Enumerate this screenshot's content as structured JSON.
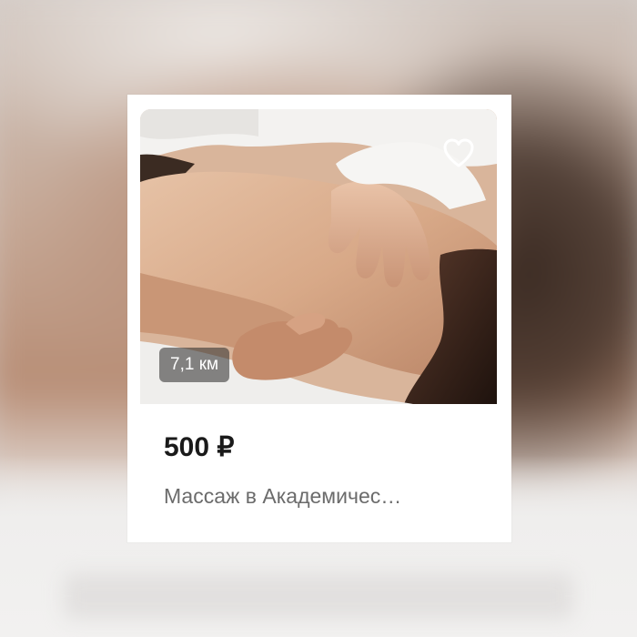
{
  "listing": {
    "price": "500 ₽",
    "title": "Массаж в Академичес…",
    "distance": "7,1 км",
    "favorite_icon": "heart-outline-icon",
    "photo_subject": "massage"
  },
  "colors": {
    "card_background": "#ffffff",
    "price_text": "#1a1a1a",
    "title_text": "#6b6b6b",
    "badge_background": "rgba(40,40,40,0.55)"
  }
}
